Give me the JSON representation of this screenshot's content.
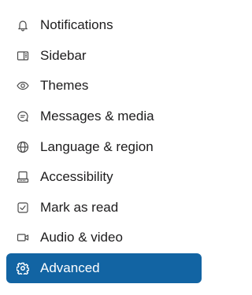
{
  "menu": {
    "active_color": "#1264a3",
    "items": [
      {
        "label": "Notifications",
        "icon": "bell-icon"
      },
      {
        "label": "Sidebar",
        "icon": "sidebar-icon"
      },
      {
        "label": "Themes",
        "icon": "eye-icon"
      },
      {
        "label": "Messages & media",
        "icon": "message-icon"
      },
      {
        "label": "Language & region",
        "icon": "globe-icon"
      },
      {
        "label": "Accessibility",
        "icon": "keyboard-icon"
      },
      {
        "label": "Mark as read",
        "icon": "checkbox-check-icon"
      },
      {
        "label": "Audio & video",
        "icon": "video-icon"
      },
      {
        "label": "Advanced",
        "icon": "gear-icon",
        "selected": true
      }
    ]
  }
}
